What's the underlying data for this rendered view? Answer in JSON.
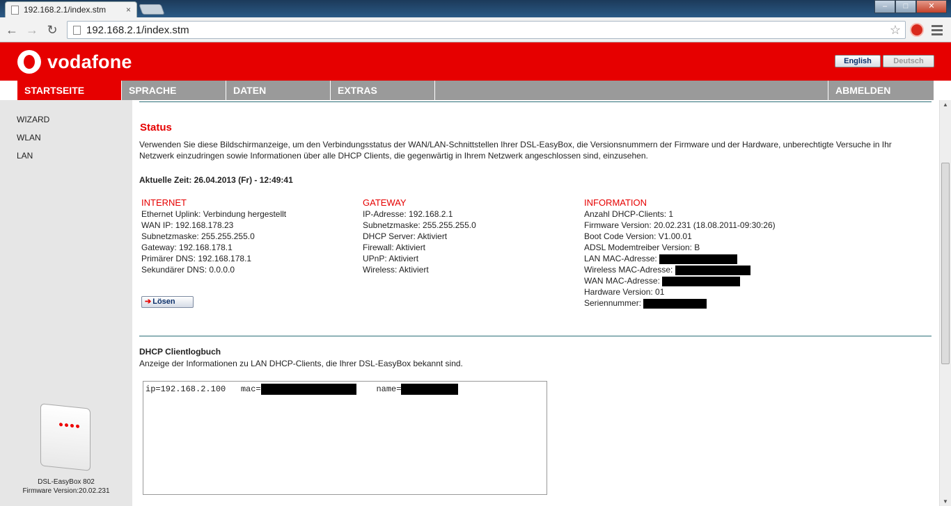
{
  "browser": {
    "tab_title": "192.168.2.1/index.stm",
    "tab_close": "×",
    "url": "192.168.2.1/index.stm",
    "back": "←",
    "forward": "→",
    "reload": "↻",
    "star": "☆"
  },
  "header": {
    "brand": "vodafone",
    "lang_en": "English",
    "lang_de": "Deutsch"
  },
  "menu": {
    "items": [
      "STARTSEITE",
      "SPRACHE",
      "DATEN",
      "EXTRAS"
    ],
    "logout": "ABMELDEN"
  },
  "sidebar": {
    "items": [
      "WIZARD",
      "WLAN",
      "LAN"
    ],
    "device_name": "DSL-EasyBox 802",
    "firmware": "Firmware Version:20.02.231"
  },
  "status": {
    "title": "Status",
    "intro": "Verwenden Sie diese Bildschirmanzeige, um den Verbindungsstatus der WAN/LAN-Schnittstellen Ihrer DSL-EasyBox, die Versionsnummern der Firmware und der Hardware, unberechtigte Versuche in Ihr Netzwerk einzudringen sowie Informationen über alle DHCP Clients, die gegenwärtig in Ihrem Netzwerk angeschlossen sind, einzusehen.",
    "time": "Aktuelle Zeit: 26.04.2013 (Fr) - 12:49:41"
  },
  "internet": {
    "heading": "INTERNET",
    "rows": [
      "Ethernet Uplink: Verbindung hergestellt",
      "WAN IP:  192.168.178.23",
      "Subnetzmaske:  255.255.255.0",
      "Gateway:  192.168.178.1",
      "Primärer DNS:  192.168.178.1",
      "Sekundärer DNS:  0.0.0.0"
    ]
  },
  "gateway": {
    "heading": "GATEWAY",
    "rows": [
      "IP-Adresse: 192.168.2.1",
      "Subnetzmaske: 255.255.255.0",
      "DHCP Server: Aktiviert",
      "Firewall: Aktiviert",
      "UPnP: Aktiviert",
      "Wireless: Aktiviert"
    ]
  },
  "information": {
    "heading": "INFORMATION",
    "rows": [
      "Anzahl DHCP-Clients:  1",
      "Firmware Version:  20.02.231 (18.08.2011-09:30:26)",
      "Boot Code Version:  V1.00.01",
      "ADSL Modemtreiber Version: B",
      "LAN MAC-Adresse:",
      "Wireless MAC-Adresse:",
      "WAN MAC-Adresse:",
      "Hardware Version:  01",
      "Seriennummer:"
    ]
  },
  "loesen_label": "Lösen",
  "dhcp": {
    "title": "DHCP Clientlogbuch",
    "desc": "Anzeige der Informationen zu LAN DHCP-Clients, die Ihrer DSL-EasyBox bekannt sind.",
    "ip": "ip=192.168.2.100",
    "mac": "mac=",
    "name": "name="
  }
}
